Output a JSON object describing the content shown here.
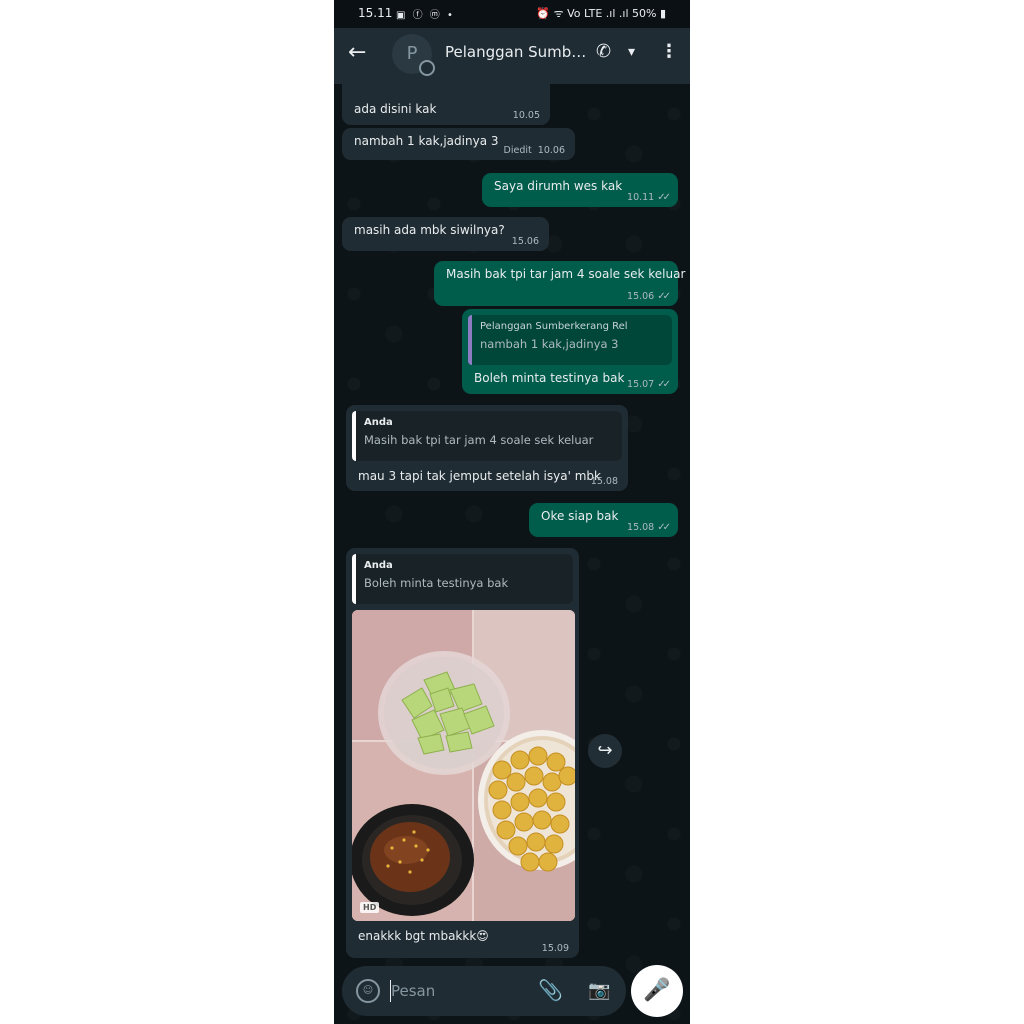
{
  "status_bar": {
    "time": "15.11",
    "app_icons": "▣ ⓕ ⓜ •",
    "right": "⏰ ᯤ Vo LTE .ıl .ıl 50% ▮"
  },
  "header": {
    "back_icon": "←",
    "avatar_letter": "P",
    "title": "Pelanggan Sumber...",
    "call_icon": "✆",
    "dropdown_icon": "▾",
    "menu_icon": "⋮"
  },
  "messages": [
    {
      "text": "ada disini kak",
      "time": "10.05"
    },
    {
      "text": "nambah 1 kak,jadinya 3",
      "edited": "Diedit",
      "time": "10.06"
    },
    {
      "text": "Saya dirumh wes kak",
      "time": "10.11",
      "ticks": "✓✓"
    },
    {
      "text": "masih ada mbk siwilnya?",
      "time": "15.06"
    },
    {
      "text": "Masih bak tpi tar jam 4 soale sek keluar",
      "time": "15.06",
      "ticks": "✓✓"
    },
    {
      "quote_name": "Pelanggan Sumberkerang Rel",
      "quote_text": "nambah 1 kak,jadinya 3",
      "text": "Boleh minta testinya bak",
      "time": "15.07",
      "ticks": "✓✓"
    },
    {
      "quote_name": "Anda",
      "quote_text": "Masih bak tpi tar jam 4 soale sek keluar",
      "text": "mau 3 tapi tak jemput setelah isya' mbk",
      "time": "15.08"
    },
    {
      "text": "Oke siap bak",
      "time": "15.08",
      "ticks": "✓✓"
    },
    {
      "quote_name": "Anda",
      "quote_text": "Boleh minta testinya bak",
      "photo_badge": "HD",
      "text": "enakkk bgt mbakkk😍",
      "time": "15.09"
    }
  ],
  "forward_icon": "↪",
  "input": {
    "placeholder": "Pesan",
    "emoji_icon": "☺",
    "attach_icon": "📎",
    "camera_icon": "📷"
  },
  "mic_icon": "🎤",
  "colors": {
    "incoming": "#202c33",
    "outgoing": "#005c4b",
    "header": "#1f2c34",
    "quote_contact": "#8e7cc3",
    "quote_self": "#ffffff"
  }
}
